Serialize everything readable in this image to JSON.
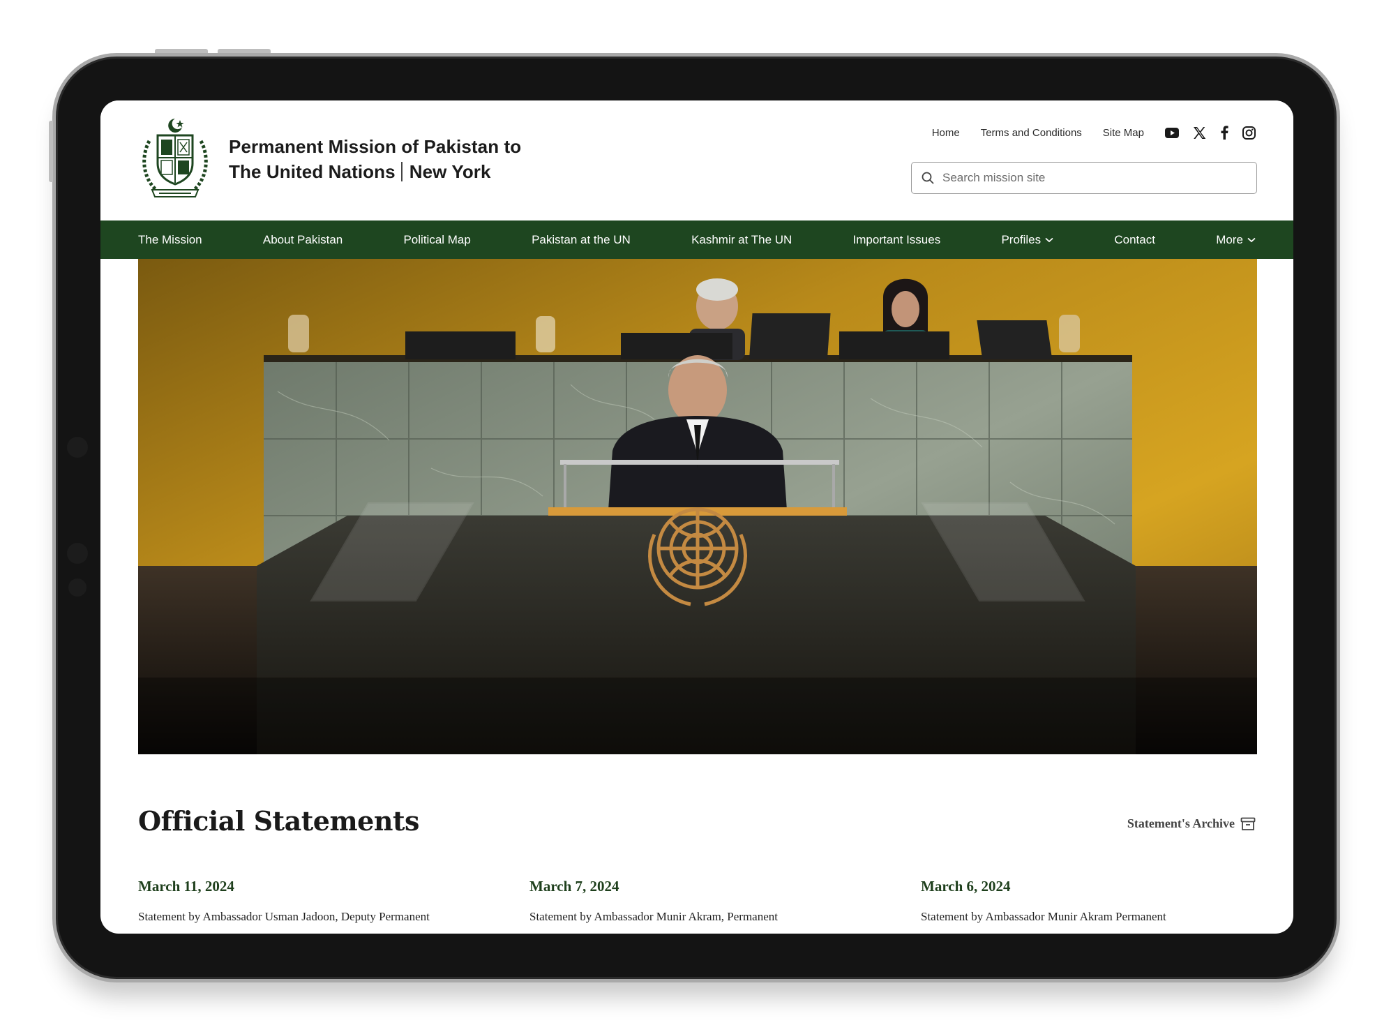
{
  "header": {
    "title_line1": "Permanent Mission of Pakistan to",
    "title_line2a": "The United Nations",
    "title_line2b": "New York",
    "links": [
      "Home",
      "Terms and Conditions",
      "Site Map"
    ],
    "social": [
      "youtube-icon",
      "x-icon",
      "facebook-icon",
      "instagram-icon"
    ],
    "search_placeholder": "Search mission site"
  },
  "nav": {
    "items": [
      "The Mission",
      "About Pakistan",
      "Political Map",
      "Pakistan at the UN",
      "Kashmir at The UN",
      "Important Issues",
      "Profiles",
      "Contact",
      "More"
    ]
  },
  "statements": {
    "title": "Official Statements",
    "archive_label": "Statement's Archive",
    "items": [
      {
        "date": "March 11, 2024",
        "text": "Statement by Ambassador Usman Jadoon, Deputy Permanent"
      },
      {
        "date": "March 7, 2024",
        "text": "Statement by Ambassador Munir Akram, Permanent"
      },
      {
        "date": "March 6, 2024",
        "text": "Statement by Ambassador Munir Akram Permanent"
      }
    ]
  },
  "colors": {
    "nav_green": "#1e4620",
    "date_green": "#1e3f1c"
  }
}
